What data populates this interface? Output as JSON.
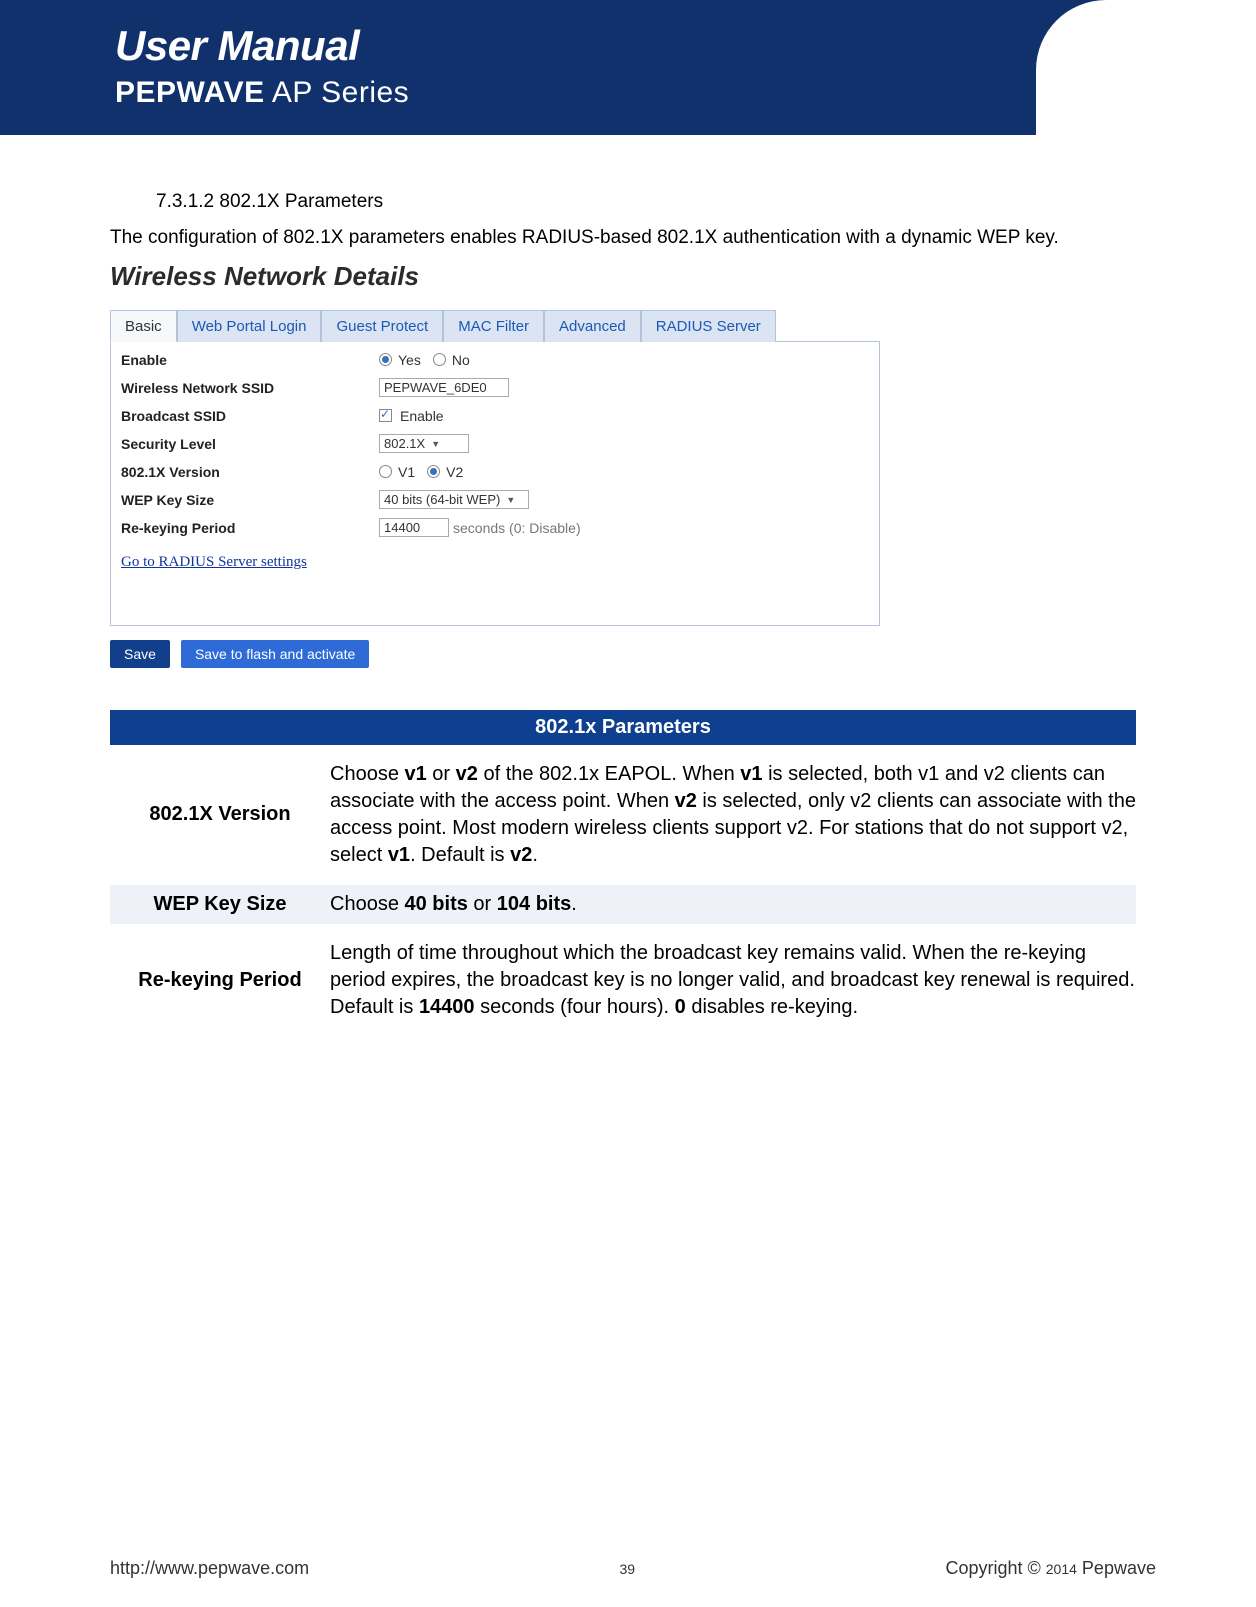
{
  "header": {
    "title": "User Manual",
    "brand_bold": "PEPWAVE",
    "brand_rest": " AP Series"
  },
  "section": {
    "number": "7.3.1.2 802.1X Parameters",
    "intro": "The configuration of 802.1X parameters enables RADIUS-based 802.1X authentication with a dynamic WEP key."
  },
  "shot": {
    "title": "Wireless Network Details",
    "tabs": [
      "Basic",
      "Web Portal Login",
      "Guest Protect",
      "MAC Filter",
      "Advanced",
      "RADIUS Server"
    ],
    "active_tab": 0,
    "rows": {
      "enable_label": "Enable",
      "enable_yes": "Yes",
      "enable_no": "No",
      "ssid_label": "Wireless Network SSID",
      "ssid_value": "PEPWAVE_6DE0",
      "broadcast_label": "Broadcast SSID",
      "broadcast_value": "Enable",
      "seclevel_label": "Security Level",
      "seclevel_value": "802.1X",
      "ver_label": "802.1X Version",
      "ver_v1": "V1",
      "ver_v2": "V2",
      "wep_label": "WEP Key Size",
      "wep_value": "40 bits (64-bit WEP)",
      "rekey_label": "Re-keying Period",
      "rekey_value": "14400",
      "rekey_suffix": "seconds (0: Disable)"
    },
    "radius_link": "Go to RADIUS Server settings",
    "btn_save": "Save",
    "btn_flash": "Save to flash and activate"
  },
  "params": {
    "title": "802.1x Parameters",
    "rows": [
      {
        "k": "802.1X Version",
        "d_pre": "Choose ",
        "d_b1": "v1",
        "d_mid1": " or ",
        "d_b2": "v2",
        "d_mid2": " of the 802.1x EAPOL. When ",
        "d_b3": "v1",
        "d_mid3": " is selected, both v1 and v2 clients can associate with the access point. When ",
        "d_b4": "v2",
        "d_mid4": " is selected, only v2 clients can associate with the access point. Most modern wireless clients support v2.   For stations that do not support v2, select ",
        "d_b5": "v1",
        "d_mid5": ". Default is ",
        "d_b6": "v2",
        "d_end": "."
      },
      {
        "k": "WEP Key Size",
        "d_pre": "Choose ",
        "d_b1": "40 bits",
        "d_mid1": " or ",
        "d_b2": "104 bits",
        "d_end": "."
      },
      {
        "k": "Re-keying Period",
        "d_pre": "Length of time throughout which the broadcast key remains valid. When the re-keying period expires, the broadcast key is no longer valid, and broadcast key renewal is required. Default is ",
        "d_b1": "14400",
        "d_mid1": " seconds (four hours). ",
        "d_b2": "0",
        "d_end": " disables re-keying."
      }
    ]
  },
  "footer": {
    "url": "http://www.pepwave.com",
    "page": "39",
    "copy_pre": "Copyright  ©  ",
    "copy_year": "2014",
    "copy_post": "  Pepwave"
  }
}
